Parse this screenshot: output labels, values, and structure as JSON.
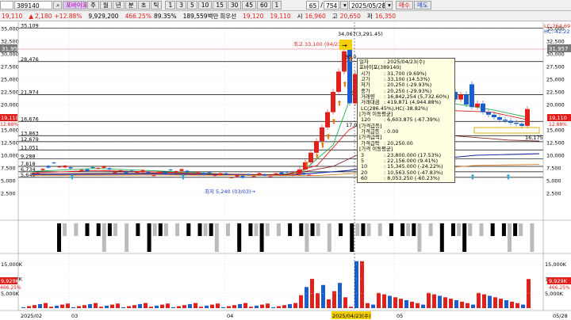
{
  "toolbar": {
    "stock_code": "389140",
    "period_buttons": [
      "주",
      "월",
      "년",
      "분",
      "초",
      "틱"
    ],
    "interval_buttons": [
      "1",
      "3",
      "5",
      "10",
      "15",
      "30",
      "45",
      "60",
      "1"
    ],
    "count_value": "65",
    "count_total": "754",
    "date_value": "2025/05/28",
    "buy_label": "매수",
    "sell_label": "매도"
  },
  "quote": {
    "price": "19,110",
    "change": "2,180",
    "change_pct": "+12.88%",
    "volume": "9,929,200",
    "vol_ratio": "466.25%",
    "turnover": "89.35%",
    "amount": "189,559백만",
    "rank_label": "회우선",
    "high_ref": "19,120",
    "open_ref": "19,110",
    "open_label": "시",
    "open": "16,960",
    "high_label": "고",
    "high": "20,650",
    "low_label": "저",
    "low": "16,350"
  },
  "price_axis": {
    "ticks": [
      "35,000",
      "32,500",
      "30,000",
      "27,500",
      "25,000",
      "22,500",
      "20,000",
      "17,500",
      "15,000",
      "12,500",
      "10,000",
      "7,500",
      "5,000",
      "2,500"
    ],
    "left_badge": "31,957",
    "right_badge": "31,957",
    "current_left": "19,110",
    "current_left_pct": "12.88%",
    "current_right": "19,110",
    "current_right_pct": "12.88%",
    "lc_label": "LC:264.69",
    "hc_label": "HC:-42.22"
  },
  "levels": [
    {
      "label": "35,109",
      "value": 35109
    },
    {
      "label": "28,476",
      "value": 28476
    },
    {
      "label": "21,974",
      "value": 21974
    },
    {
      "label": "16,676",
      "value": 16676
    },
    {
      "label": "13,863",
      "value": 13863
    },
    {
      "label": "12,679",
      "value": 12679
    },
    {
      "label": "11,051",
      "value": 11051
    },
    {
      "label": "9,288",
      "value": 9288
    },
    {
      "label": "7,818",
      "value": 7818
    },
    {
      "label": "6,734",
      "value": 6734
    },
    {
      "label": "5,645",
      "value": 5645
    }
  ],
  "annotations": {
    "max_point": "34,067(3,291.45)",
    "high_note": "최고 33,100 (04/23)→",
    "low_note": "최저 5,240 (03/03)→",
    "mid_price": "30,0",
    "right_price": "16,175",
    "mid_left": "17,0"
  },
  "volume_axis": {
    "ticks": [
      "15,000K",
      "10,000K",
      "5,000K"
    ],
    "left_badge": "9,929K",
    "left_pct": "466.25%",
    "right_badge": "9,929K",
    "right_pct": "466.25%"
  },
  "date_axis": {
    "labels": [
      "2025/02",
      "03",
      "04",
      "05"
    ],
    "highlight": "2025/04/23(수)",
    "right_label": "05/28"
  },
  "tooltip": {
    "rows": [
      {
        "k": "일자",
        "v": ": 2025/04/23(수)"
      },
      {
        "k": "포바이포(389140)",
        "v": ""
      },
      {
        "k": " 시가",
        "v": ": 31,700 (9.69%)"
      },
      {
        "k": " 고가",
        "v": ": 33,100 (14.53%)"
      },
      {
        "k": " 저가",
        "v": ": 20,250 (-29.93%)"
      },
      {
        "k": " 종가",
        "v": ": 20,250 (-29.93%)"
      },
      {
        "k": " 거래량",
        "v": ": 16,842,254 (5,732.60%)"
      },
      {
        "k": " 거래대금",
        "v": ": 419,871 (4,944.88%)"
      },
      {
        "k": " LC(286.45%),HC(-38.82%)",
        "v": ""
      },
      {
        "k": "[가격 이동평균]",
        "v": ""
      },
      {
        "k": " 120",
        "v": ": 6,603.875 (-67.39%)"
      },
      {
        "k": "[가격급등]",
        "v": ""
      },
      {
        "k": " 가격급등",
        "v": ": 0.00"
      },
      {
        "k": "[가격급락]",
        "v": ""
      },
      {
        "k": " 가격급락",
        "v": ": 20,250.00"
      },
      {
        "k": "[가격 이동평균]",
        "v": ""
      },
      {
        "k": " 3",
        "v": ": 23,800.000 (17.53%)"
      },
      {
        "k": " 5",
        "v": ": 22,156.000 (9.41%)"
      },
      {
        "k": " 10",
        "v": ": 15,345.000 (-24.22%)"
      },
      {
        "k": " 20",
        "v": ": 10,563.500 (-47.83%)"
      },
      {
        "k": " 60",
        "v": ": 8,053.250 (-60.23%)"
      }
    ]
  },
  "colors": {
    "up": "#e0201c",
    "down": "#1a5fcc"
  }
}
